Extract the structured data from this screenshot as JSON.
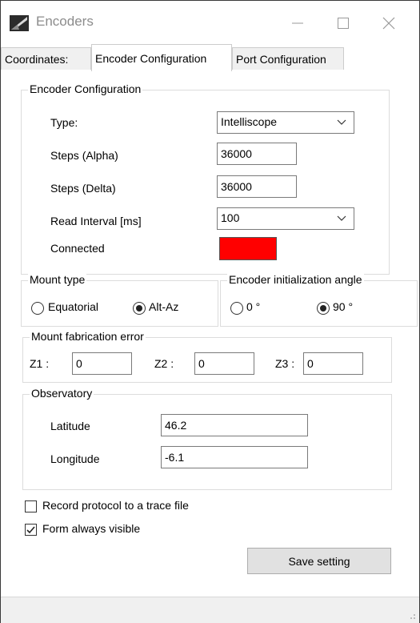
{
  "window": {
    "title": "Encoders"
  },
  "tabs": [
    {
      "label": "Coordinates:"
    },
    {
      "label": "Encoder Configuration"
    },
    {
      "label": "Port Configuration"
    }
  ],
  "encoder_config": {
    "legend": "Encoder Configuration",
    "type_label": "Type:",
    "type_value": "Intelliscope",
    "steps_alpha_label": "Steps (Alpha)",
    "steps_alpha_value": "36000",
    "steps_delta_label": "Steps (Delta)",
    "steps_delta_value": "36000",
    "read_interval_label": "Read Interval [ms]",
    "read_interval_value": "100",
    "connected_label": "Connected",
    "connected_color": "#ff0000"
  },
  "mount_type": {
    "legend": "Mount type",
    "options": [
      {
        "label": "Equatorial",
        "checked": false
      },
      {
        "label": "Alt-Az",
        "checked": true
      }
    ]
  },
  "init_angle": {
    "legend": "Encoder initialization angle",
    "options": [
      {
        "label": "0 °",
        "checked": false
      },
      {
        "label": "90 °",
        "checked": true
      }
    ]
  },
  "fab_error": {
    "legend": "Mount fabrication error",
    "z1_label": "Z1 :",
    "z1_value": "0",
    "z2_label": "Z2 :",
    "z2_value": "0",
    "z3_label": "Z3 :",
    "z3_value": "0"
  },
  "observatory": {
    "legend": "Observatory",
    "latitude_label": "Latitude",
    "latitude_value": "46.2",
    "longitude_label": "Longitude",
    "longitude_value": "-6.1"
  },
  "options": {
    "record_label": "Record protocol to a trace file",
    "record_checked": false,
    "visible_label": "Form always visible",
    "visible_checked": true
  },
  "save_button": {
    "label": "Save setting"
  }
}
